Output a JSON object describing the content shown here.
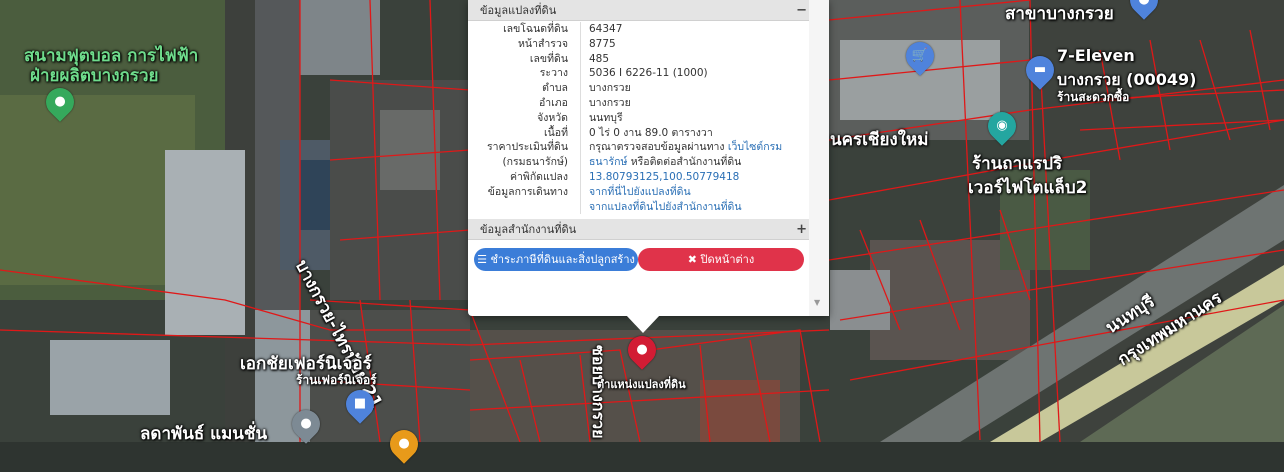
{
  "map_labels": [
    {
      "key": "stadium",
      "text": "สนามฟุตบอล การไฟฟ้า",
      "color": "green"
    },
    {
      "key": "stadium2",
      "text": "ฝ่ายผลิตบางกรวย",
      "color": "green"
    },
    {
      "key": "branch",
      "text": "สาขาบางกรวย",
      "color": "white"
    },
    {
      "key": "seven",
      "text": "7-Eleven",
      "color": "white"
    },
    {
      "key": "seven2",
      "text": "บางกรวย (00049)",
      "color": "white"
    },
    {
      "key": "seven3",
      "text": "ร้านสะดวกซื้อ",
      "color": "white"
    },
    {
      "key": "city",
      "text": "นครเชียงใหม่",
      "color": "white"
    },
    {
      "key": "bakery",
      "text": "ร้านถาแรปริ",
      "color": "white"
    },
    {
      "key": "bakery2",
      "text": "เวอร์ไฟโตแล็บ2",
      "color": "white"
    },
    {
      "key": "road1",
      "text": "บางกรวย-ไทรน้อย 21",
      "color": "white"
    },
    {
      "key": "road2",
      "text": "นนทบุรี",
      "color": "white"
    },
    {
      "key": "road3",
      "text": "กรุงเทพมหานคร",
      "color": "white"
    },
    {
      "key": "furniture",
      "text": "เอกชัยเฟอร์นิเจอร์",
      "color": "white"
    },
    {
      "key": "furniture2",
      "text": "ร้านเฟอร์นิเจอร์",
      "color": "white"
    },
    {
      "key": "soi",
      "text": "ซอยบางกรวย",
      "color": "white"
    },
    {
      "key": "parcel",
      "text": "ตำแหน่งแปลงที่ดิน",
      "color": "white"
    },
    {
      "key": "mansion",
      "text": "ลดาพันธ์ แมนชั่น",
      "color": "white"
    }
  ],
  "popup": {
    "section1_title": "ข้อมูลแปลงที่ดิน",
    "section1_toggle": "−",
    "rows": [
      {
        "label": "เลขโฉนดที่ดิน",
        "value": "64347"
      },
      {
        "label": "หน้าสำรวจ",
        "value": "8775"
      },
      {
        "label": "เลขที่ดิน",
        "value": "485"
      },
      {
        "label": "ระวาง",
        "value": "5036 I 6226-11 (1000)"
      },
      {
        "label": "ตำบล",
        "value": "บางกรวย"
      },
      {
        "label": "อำเภอ",
        "value": "บางกรวย"
      },
      {
        "label": "จังหวัด",
        "value": "นนทบุรี"
      },
      {
        "label": "เนื้อที่",
        "value": "0 ไร่ 0 งาน 89.0 ตารางวา"
      }
    ],
    "price_label": "ราคาประเมินที่ดิน",
    "price_label2": "(กรมธนารักษ์)",
    "price_text": "กรุณาตรวจสอบข้อมูลผ่านทาง ",
    "price_link": "เว็บไซต์กรม",
    "price_link2": "ธนารักษ์",
    "price_text2": " หรือติดต่อสำนักงานที่ดิน",
    "coord_label": "ค่าพิกัดแปลง",
    "coord_value": "13.80793125,100.50779418",
    "travel_label": "ข้อมูลการเดินทาง",
    "travel_link1": "จากที่นี่ไปยังแปลงที่ดิน",
    "travel_link2": "จากแปลงที่ดินไปยังสำนักงานที่ดิน",
    "section2_title": "ข้อมูลสำนักงานที่ดิน",
    "section2_toggle": "+",
    "tax_button": "ชำระภาษีที่ดินและสิ่งปลูกสร้าง",
    "close_button": "ปิดหน้าต่าง",
    "colors": {
      "tax": "#3b7dd8",
      "close": "#e0334a",
      "link": "#2a6fb5"
    }
  }
}
